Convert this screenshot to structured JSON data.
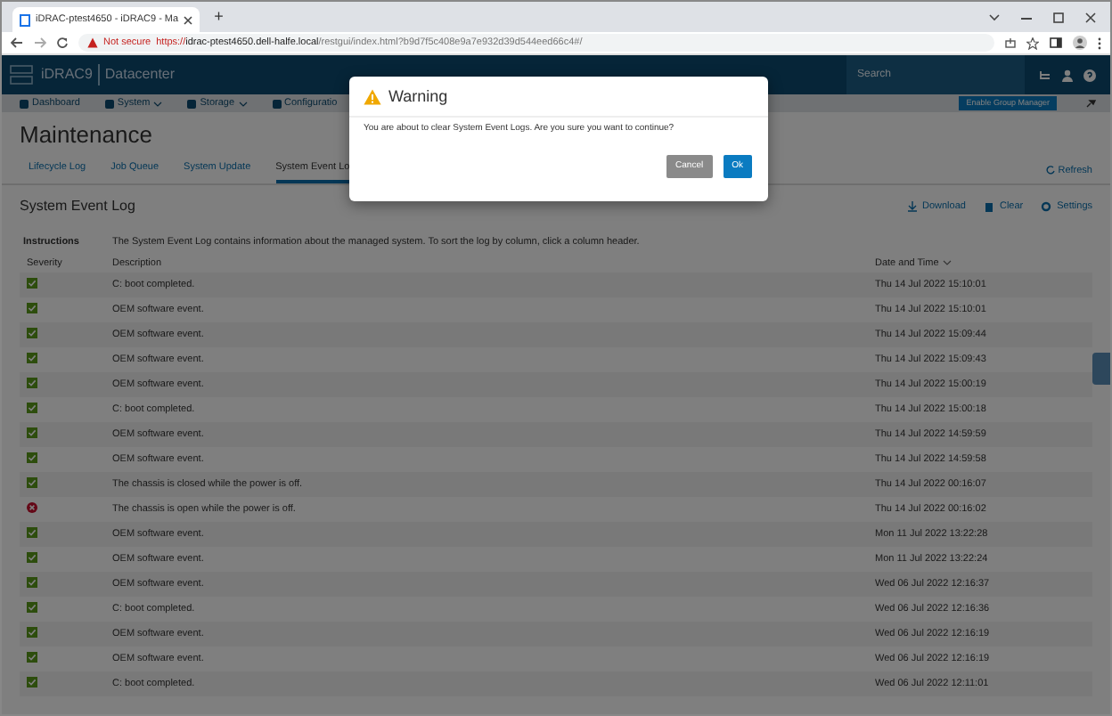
{
  "browser": {
    "tab_title": "iDRAC-ptest4650 - iDRAC9 - Ma",
    "new_tab": "+",
    "security": "Not secure",
    "url_scheme": "https://",
    "url_host": "idrac-ptest4650.dell-halfe.local",
    "url_path": "/restgui/index.html?b9d7f5c408e9a7e932d39d544eed66c4#/"
  },
  "header": {
    "product": "iDRAC9",
    "edition": "Datacenter",
    "search_placeholder": "Search"
  },
  "nav": [
    {
      "label": "Dashboard",
      "dropdown": false
    },
    {
      "label": "System",
      "dropdown": true
    },
    {
      "label": "Storage",
      "dropdown": true
    },
    {
      "label": "Configuratio",
      "dropdown": false
    }
  ],
  "group_manager_button": "Enable Group Manager",
  "page_title": "Maintenance",
  "tabs": [
    {
      "label": "Lifecycle Log",
      "selected": false
    },
    {
      "label": "Job Queue",
      "selected": false
    },
    {
      "label": "System Update",
      "selected": false
    },
    {
      "label": "System Event Lo",
      "selected": true
    }
  ],
  "refresh": "Refresh",
  "section": {
    "title": "System Event Log",
    "actions": [
      "Download",
      "Clear",
      "Settings"
    ]
  },
  "instructions": {
    "label": "Instructions",
    "text": "The System Event Log contains information about the managed system. To sort the log by column, click a column header."
  },
  "table": {
    "columns": [
      "Severity",
      "Description",
      "Date and Time"
    ],
    "rows": [
      {
        "kind": "ok",
        "description": "C: boot completed.",
        "time": "Thu 14 Jul 2022 15:10:01"
      },
      {
        "kind": "ok",
        "description": "OEM software event.",
        "time": "Thu 14 Jul 2022 15:10:01"
      },
      {
        "kind": "ok",
        "description": "OEM software event.",
        "time": "Thu 14 Jul 2022 15:09:44"
      },
      {
        "kind": "ok",
        "description": "OEM software event.",
        "time": "Thu 14 Jul 2022 15:09:43"
      },
      {
        "kind": "ok",
        "description": "OEM software event.",
        "time": "Thu 14 Jul 2022 15:00:19"
      },
      {
        "kind": "ok",
        "description": "C: boot completed.",
        "time": "Thu 14 Jul 2022 15:00:18"
      },
      {
        "kind": "ok",
        "description": "OEM software event.",
        "time": "Thu 14 Jul 2022 14:59:59"
      },
      {
        "kind": "ok",
        "description": "OEM software event.",
        "time": "Thu 14 Jul 2022 14:59:58"
      },
      {
        "kind": "ok",
        "description": "The chassis is closed while the power is off.",
        "time": "Thu 14 Jul 2022 00:16:07"
      },
      {
        "kind": "critical",
        "description": "The chassis is open while the power is off.",
        "time": "Thu 14 Jul 2022 00:16:02"
      },
      {
        "kind": "ok",
        "description": "OEM software event.",
        "time": "Mon 11 Jul 2022 13:22:28"
      },
      {
        "kind": "ok",
        "description": "OEM software event.",
        "time": "Mon 11 Jul 2022 13:22:24"
      },
      {
        "kind": "ok",
        "description": "OEM software event.",
        "time": "Wed 06 Jul 2022 12:16:37"
      },
      {
        "kind": "ok",
        "description": "C: boot completed.",
        "time": "Wed 06 Jul 2022 12:16:36"
      },
      {
        "kind": "ok",
        "description": "OEM software event.",
        "time": "Wed 06 Jul 2022 12:16:19"
      },
      {
        "kind": "ok",
        "description": "OEM software event.",
        "time": "Wed 06 Jul 2022 12:16:19"
      },
      {
        "kind": "ok",
        "description": "C: boot completed.",
        "time": "Wed 06 Jul 2022 12:11:01"
      }
    ]
  },
  "dialog": {
    "title": "Warning",
    "message": "You are about to clear System Event Logs. Are you sure you want to continue?",
    "buttons": [
      {
        "label": "Cancel",
        "kind": "secondary"
      },
      {
        "label": "Ok",
        "kind": "primary"
      }
    ]
  }
}
